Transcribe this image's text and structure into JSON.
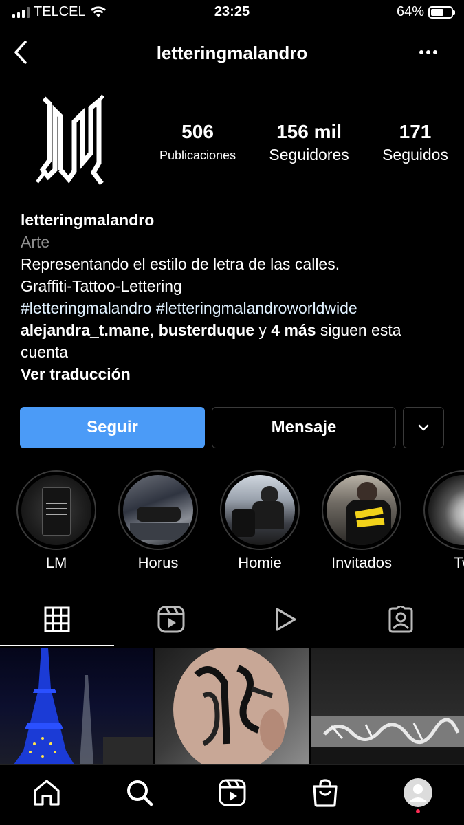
{
  "status_bar": {
    "carrier": "TELCEL",
    "time": "23:25",
    "battery": "64%",
    "battery_level": 0.64
  },
  "header": {
    "username": "letteringmalandro"
  },
  "profile": {
    "avatar_text": "LM",
    "stats": [
      {
        "value": "506",
        "label": "Publicaciones"
      },
      {
        "value": "156 mil",
        "label": "Seguidores"
      },
      {
        "value": "171",
        "label": "Seguidos"
      }
    ]
  },
  "bio": {
    "name": "letteringmalandro",
    "category": "Arte",
    "line1": "Representando el estilo de letra de las calles.",
    "line2": "Graffiti-Tattoo-Lettering",
    "hashtags": "#letteringmalandro #letteringmalandroworldwide",
    "followed_by_user1": "alejandra_t.mane",
    "followed_by_sep": ", ",
    "followed_by_user2": "busterduque",
    "followed_by_y": " y ",
    "followed_by_more": "4 más",
    "followed_by_suffix": " siguen esta cuenta",
    "translate": "Ver traducción"
  },
  "actions": {
    "follow": "Seguir",
    "message": "Mensaje"
  },
  "highlights": [
    {
      "label": "LM"
    },
    {
      "label": "Horus"
    },
    {
      "label": "Homie"
    },
    {
      "label": "Invitados"
    },
    {
      "label": "Tw"
    }
  ],
  "tabs": [
    "grid-icon",
    "reels-icon",
    "video-icon",
    "tagged-icon"
  ],
  "colors": {
    "accent": "#4b9bf7",
    "background": "#000000",
    "muted": "#8e8e8e",
    "hashtag": "#e0f1ff",
    "notification": "#ff2d55"
  }
}
